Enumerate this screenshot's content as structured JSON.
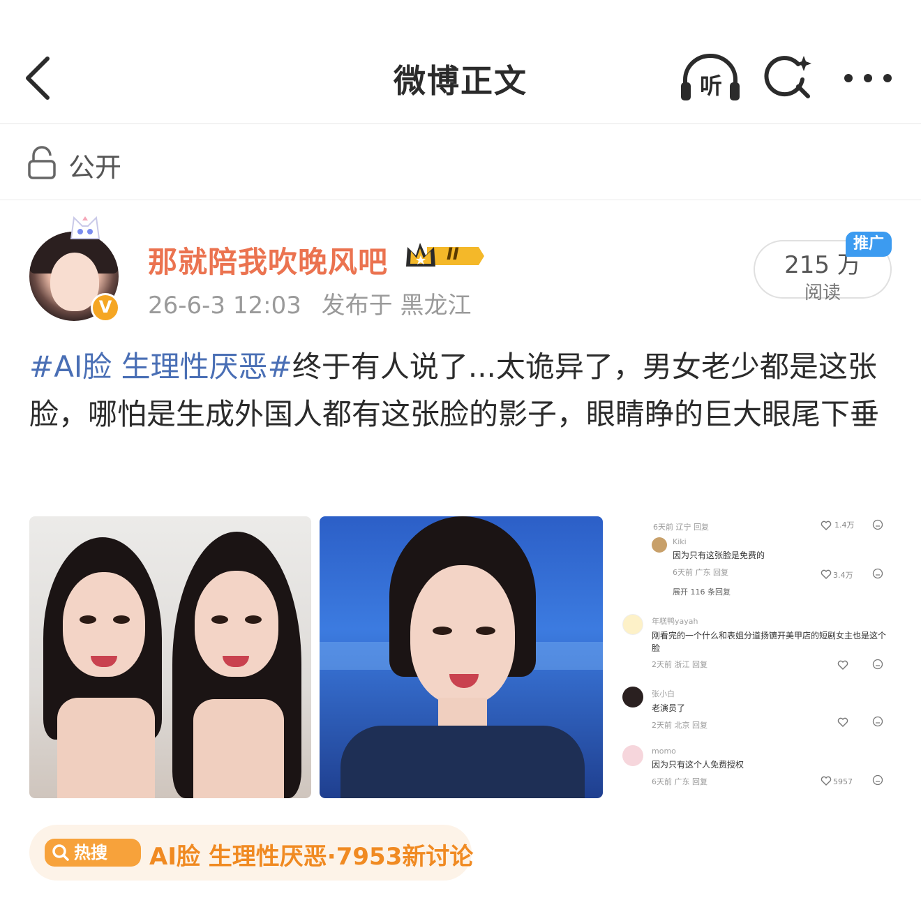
{
  "header": {
    "title": "微博正文",
    "listen_label": "听"
  },
  "visibility": {
    "label": "公开"
  },
  "author": {
    "name": "那就陪我吹晚风吧",
    "badge_text": "II",
    "vip_mark": "V",
    "date": "26-6-3 12:03",
    "location": "发布于 黑龙江"
  },
  "read": {
    "count": "215 万",
    "label": "阅读",
    "promo_tag": "推广"
  },
  "post": {
    "hashtag": "#AI脸 生理性厌恶#",
    "text": "终于有人说了...太诡异了，男女老少都是这张脸，哪怕是生成外国人都有这张脸的影子，眼睛睁的巨大眼尾下垂"
  },
  "comments": [
    {
      "meta": "6天前 辽宁  回复",
      "likes": "1.4万"
    },
    {
      "name": "Kiki",
      "text": "因为只有这张脸是免费的",
      "meta": "6天前 广东  回复",
      "likes": "3.4万"
    },
    {
      "expand": "展开 116 条回复"
    },
    {
      "name": "年糕鸭yayah",
      "text": "刚看完的一个什么和表姐分道扬镳开美甲店的短剧女主也是这个脸",
      "meta": "2天前 浙江  回复"
    },
    {
      "name": "张小白",
      "text": "老演员了",
      "meta": "2天前 北京  回复"
    },
    {
      "name": "momo",
      "text": "因为只有这个人免费授权",
      "meta": "6天前 广东  回复",
      "likes": "5957"
    }
  ],
  "hot_search": {
    "badge": "热搜",
    "text": "AI脸 生理性厌恶·7953新讨论"
  },
  "colors": {
    "accent_orange": "#eb7350",
    "hashtag_blue": "#4a6fb5",
    "promo_blue": "#3c9bf0",
    "hot_orange": "#f7a23b"
  },
  "icons": [
    "back-arrow-icon",
    "headphones-icon",
    "search-sparkle-icon",
    "more-dots-icon",
    "lock-icon",
    "crown-icon",
    "search-icon",
    "heart-icon",
    "emoji-icon"
  ]
}
